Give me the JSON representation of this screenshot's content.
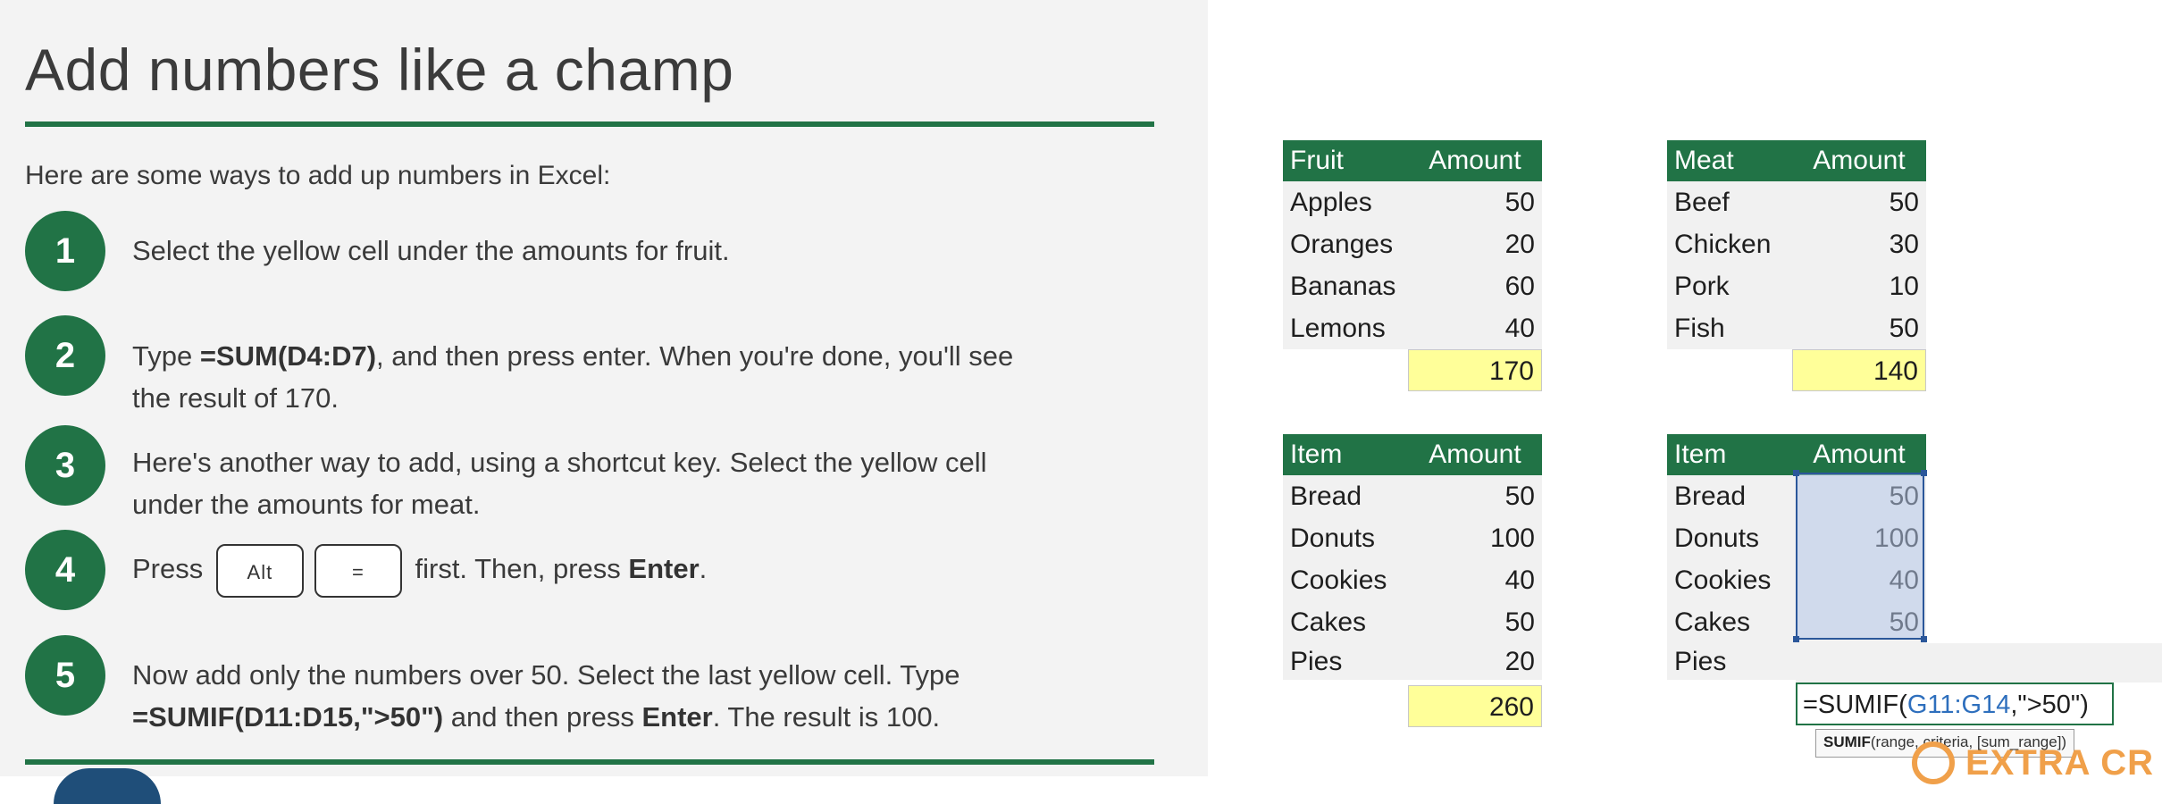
{
  "lesson": {
    "title": "Add numbers like a champ",
    "intro": "Here are some ways to add up numbers in Excel:",
    "steps": [
      {
        "number": "1",
        "text": "Select the yellow cell under the amounts for fruit."
      },
      {
        "number": "2",
        "text_before": "Type ",
        "bold1": "=SUM(D4:D7)",
        "text_after": ", and then press enter. When you're done, you'll see",
        "line2": "the result of 170."
      },
      {
        "number": "3",
        "line1": "Here's another way to add, using a shortcut key. Select the yellow cell",
        "line2": "under the amounts for meat."
      },
      {
        "number": "4",
        "text_before": "Press",
        "key1": "Alt",
        "key2": "=",
        "text_mid": "first. Then, press ",
        "bold1": "Enter",
        "text_after": "."
      },
      {
        "number": "5",
        "line1": "Now add only the numbers over 50. Select the last yellow cell. Type",
        "bold1": "=SUMIF(D11:D15,\">50\")",
        "text_mid": " and then press ",
        "bold2": "Enter",
        "text_after": ". The result is 100."
      }
    ]
  },
  "tables": {
    "fruit": {
      "header": [
        "Fruit",
        "Amount"
      ],
      "rows": [
        [
          "Apples",
          "50"
        ],
        [
          "Oranges",
          "20"
        ],
        [
          "Bananas",
          "60"
        ],
        [
          "Lemons",
          "40"
        ]
      ],
      "total": "170"
    },
    "meat": {
      "header": [
        "Meat",
        "Amount"
      ],
      "rows": [
        [
          "Beef",
          "50"
        ],
        [
          "Chicken",
          "30"
        ],
        [
          "Pork",
          "10"
        ],
        [
          "Fish",
          "50"
        ]
      ],
      "total": "140"
    },
    "items1": {
      "header": [
        "Item",
        "Amount"
      ],
      "rows": [
        [
          "Bread",
          "50"
        ],
        [
          "Donuts",
          "100"
        ],
        [
          "Cookies",
          "40"
        ],
        [
          "Cakes",
          "50"
        ],
        [
          "Pies",
          "20"
        ]
      ],
      "total": "260"
    },
    "items2": {
      "header": [
        "Item",
        "Amount"
      ],
      "rows": [
        [
          "Bread",
          "50"
        ],
        [
          "Donuts",
          "100"
        ],
        [
          "Cookies",
          "40"
        ],
        [
          "Cakes",
          "50"
        ],
        [
          "Pies",
          ""
        ]
      ]
    }
  },
  "formula": {
    "prefix": "=SUMIF(",
    "range": "G11:G14",
    "suffix": ",\">50\")"
  },
  "tooltip": {
    "func": "SUMIF",
    "args": "(range, criteria, [sum_range])"
  },
  "watermark": {
    "text": "EXTRA CR"
  },
  "colors": {
    "accent": "#217346",
    "total_cell": "#ffff99",
    "selection": "#2b579a",
    "formula_ref": "#2e6fbd"
  }
}
